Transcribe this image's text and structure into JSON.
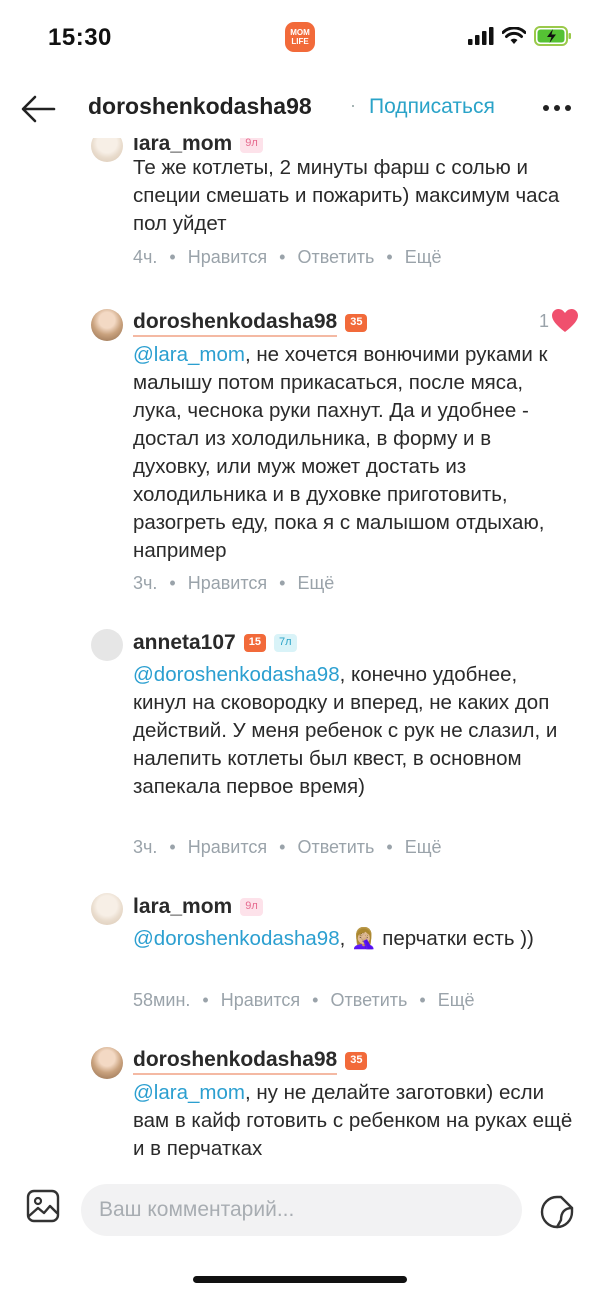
{
  "status": {
    "time": "15:30",
    "app_logo_text_1": "MOM",
    "app_logo_text_2": "LIFE"
  },
  "header": {
    "username": "doroshenkodasha98",
    "separator": "·",
    "follow_label": "Подписаться"
  },
  "comments": [
    {
      "user": "lara_mom",
      "badges": [
        "9л"
      ],
      "text": "Те же котлеты, 2 минуты фарш с солью и специи смешать и пожарить) максимум часа пол уйдет",
      "time": "4ч.",
      "like": "Нравится",
      "reply": "Ответить",
      "more": "Ещё"
    },
    {
      "user": "doroshenkodasha98",
      "badges": [
        "35"
      ],
      "mention": "@lara_mom",
      "text": ", не хочется вонючими руками к малышу потом прикасаться, после мяса, лука, чеснока руки пахнут. Да и удобнее - достал из холодильника, в форму и в духовку, или муж может достать из холодильника и в духовке приготовить, разогреть еду, пока я с малышом отдыхаю, например",
      "likes": "1",
      "time": "3ч.",
      "like": "Нравится",
      "more": "Ещё"
    },
    {
      "user": "anneta107",
      "badges": [
        "15",
        "7л"
      ],
      "mention": "@doroshenkodasha98",
      "text": ", конечно удобнее, кинул на сковородку и вперед, не каких доп действий. У меня ребенок с рук не слазил, и налепить котлеты был квест, в основном запекала первое время)",
      "time": "3ч.",
      "like": "Нравится",
      "reply": "Ответить",
      "more": "Ещё"
    },
    {
      "user": "lara_mom",
      "badges": [
        "9л"
      ],
      "mention": "@doroshenkodasha98",
      "text": ", 🤦🏼‍♀️ перчатки есть ))",
      "time": "58мин.",
      "like": "Нравится",
      "reply": "Ответить",
      "more": "Ещё"
    },
    {
      "user": "doroshenkodasha98",
      "badges": [
        "35"
      ],
      "mention": "@lara_mom",
      "text": ", ну не делайте заготовки) если вам в кайф готовить с ребенком на руках ещё и в перчатках"
    }
  ],
  "composer": {
    "placeholder": "Ваш комментарий..."
  },
  "colors": {
    "accent": "#2aa3c8",
    "mention": "#2b9fd0",
    "badge_orange": "#f26a3a",
    "heart": "#f0506e"
  }
}
